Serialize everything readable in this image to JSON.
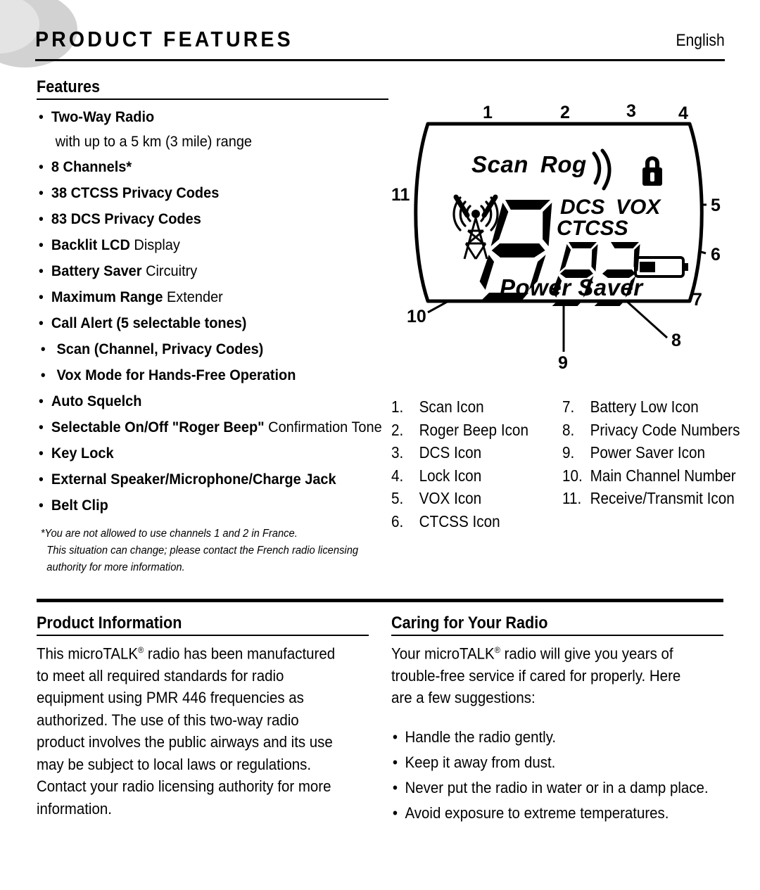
{
  "header": {
    "title": "PRODUCT FEATURES",
    "language": "English"
  },
  "features": {
    "heading": "Features",
    "items": [
      {
        "strong": "Two-Way Radio",
        "light": "",
        "sub": "with up to a 5 km (3 mile) range",
        "indented": false
      },
      {
        "strong": "8 Channels*",
        "light": "",
        "sub": "",
        "indented": false
      },
      {
        "strong": "38 CTCSS Privacy Codes",
        "light": "",
        "sub": "",
        "indented": false
      },
      {
        "strong": "83 DCS Privacy Codes",
        "light": "",
        "sub": "",
        "indented": false
      },
      {
        "strong": "Backlit LCD",
        "light": " Display",
        "sub": "",
        "indented": false
      },
      {
        "strong": "Battery Saver",
        "light": " Circuitry",
        "sub": "",
        "indented": false
      },
      {
        "strong": "Maximum Range",
        "light": " Extender",
        "sub": "",
        "indented": false
      },
      {
        "strong": "Call Alert (5 selectable tones)",
        "light": "",
        "sub": "",
        "indented": false
      },
      {
        "strong": "Scan (Channel, Privacy Codes)",
        "light": "",
        "sub": "",
        "indented": true
      },
      {
        "strong": "Vox Mode for Hands-Free Operation",
        "light": "",
        "sub": "",
        "indented": true
      },
      {
        "strong": "Auto Squelch",
        "light": "",
        "sub": "",
        "indented": false
      },
      {
        "strong": "Selectable On/Off \"Roger Beep\"",
        "light": " Confirmation Tone",
        "sub": "",
        "indented": false
      },
      {
        "strong": "Key Lock",
        "light": "",
        "sub": "",
        "indented": false
      },
      {
        "strong": "External Speaker/Microphone/Charge Jack",
        "light": "",
        "sub": "",
        "indented": false
      },
      {
        "strong": "Belt Clip",
        "light": "",
        "sub": "",
        "indented": false
      }
    ],
    "bullet_glyph": "•",
    "footnote_line1": "*You are not allowed to use channels 1 and 2 in France.",
    "footnote_line2": "This situation can change; please contact the French radio licensing",
    "footnote_line3": "authority for more information."
  },
  "display": {
    "lcd_segments": {
      "scan_label": "Scan",
      "roger_label": "Rog",
      "dcs_label": "DCS",
      "vox_label": "VOX",
      "ctcss_label": "CTCSS",
      "power_saver_label": "Power Saver",
      "main_channel_digit": "8",
      "privacy_code_digits": "83"
    },
    "icons": {
      "roger_beep": "signal-arcs-icon",
      "lock": "padlock-icon",
      "battery": "battery-low-icon",
      "receive_transmit": "radio-tower-icon"
    },
    "callouts": [
      "1",
      "2",
      "3",
      "4",
      "5",
      "6",
      "7",
      "8",
      "9",
      "10",
      "11"
    ]
  },
  "legend": {
    "left": [
      {
        "num": "1.",
        "label": "Scan Icon"
      },
      {
        "num": "2.",
        "label": "Roger Beep Icon"
      },
      {
        "num": "3.",
        "label": "DCS Icon"
      },
      {
        "num": "4.",
        "label": "Lock Icon"
      },
      {
        "num": "5.",
        "label": "VOX Icon"
      },
      {
        "num": "6.",
        "label": "CTCSS Icon"
      }
    ],
    "right": [
      {
        "num": "7.",
        "label": "Battery Low Icon"
      },
      {
        "num": "8.",
        "label": "Privacy Code Numbers"
      },
      {
        "num": "9.",
        "label": "Power Saver Icon"
      },
      {
        "num": "10.",
        "label": "Main Channel Number"
      },
      {
        "num": "11.",
        "label": "Receive/Transmit Icon"
      }
    ]
  },
  "product_information": {
    "heading": "Product Information",
    "body_pre": "This microTALK",
    "body_sup": "®",
    "body_post": " radio has been manufactured to meet all required standards for radio equipment using PMR 446 frequencies as authorized. The use of this two-way radio product involves the public airways and its use may be subject to local laws or regulations. Contact your radio licensing authority for more information."
  },
  "caring": {
    "heading": "Caring for Your Radio",
    "body_pre": "Your microTALK",
    "body_sup": "®",
    "body_post": " radio will give you years of trouble-free service if cared for properly. Here are a few suggestions:",
    "bullet_glyph": "•",
    "items": [
      "Handle the radio gently.",
      "Keep it away from dust.",
      "Never put the radio in water or in a damp place.",
      "Avoid exposure to extreme temperatures."
    ]
  }
}
